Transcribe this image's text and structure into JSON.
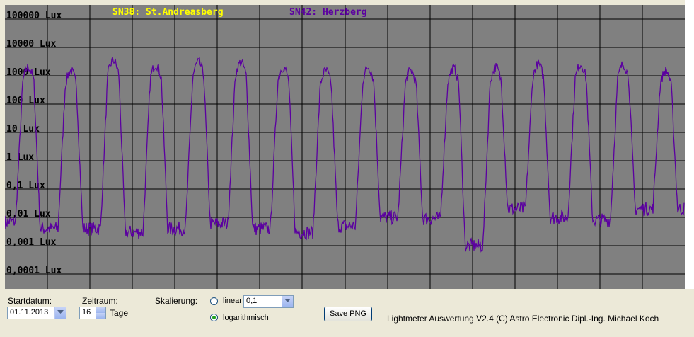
{
  "chart_data": {
    "type": "line",
    "title": "",
    "legend": [
      {
        "name": "SN38: St.Andreasberg",
        "color": "#ffff00"
      },
      {
        "name": "SN42: Herzberg",
        "color": "#5b00a0"
      }
    ],
    "y_scale": "log",
    "ylim": [
      0.0001,
      100000
    ],
    "y_tick_labels": [
      "100000 Lux",
      "10000 Lux",
      "1000 Lux",
      "100 Lux",
      "10 Lux",
      "1 Lux",
      "0,1 Lux",
      "0,01 Lux",
      "0,001 Lux",
      "0,0001 Lux"
    ],
    "grid": true,
    "background_color": "#808080",
    "days": 16,
    "series": [
      {
        "name": "SN42: Herzberg",
        "color": "#5b00a0",
        "day_peak_lux": [
          2000,
          1500,
          3500,
          2500,
          3000,
          3000,
          2000,
          1500,
          2000,
          1500,
          1800,
          2000,
          2500,
          2500,
          2500,
          1500
        ],
        "night_lux": [
          0.007,
          0.004,
          0.004,
          0.003,
          0.004,
          0.006,
          0.004,
          0.003,
          0.005,
          0.01,
          0.009,
          0.001,
          0.02,
          0.01,
          0.008,
          0.02
        ]
      }
    ]
  },
  "controls": {
    "startdatum_label": "Startdatum:",
    "startdatum_value": "01.11.2013",
    "zeitraum_label": "Zeitraum:",
    "zeitraum_value": "16",
    "zeitraum_unit": "Tage",
    "skalierung_label": "Skalierung:",
    "linear_label": "linear",
    "linear_value": "0,1",
    "log_label": "logarithmisch",
    "scale_selected": "logarithmisch",
    "save_button": "Save PNG",
    "app_info": "Lightmeter Auswertung V2.4  (C) Astro Electronic Dipl.-Ing. Michael Koch"
  }
}
